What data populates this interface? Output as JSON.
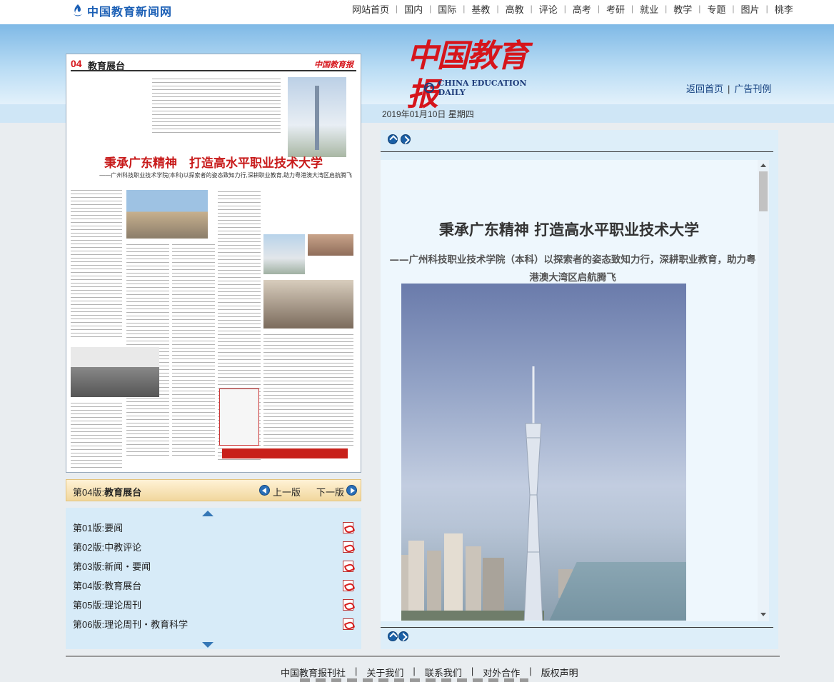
{
  "site": {
    "logo_text": "中国教育新闻网"
  },
  "topnav": [
    "网站首页",
    "国内",
    "国际",
    "基教",
    "高教",
    "评论",
    "高考",
    "考研",
    "就业",
    "教学",
    "专题",
    "图片",
    "桃李"
  ],
  "masthead": {
    "title": "中国教育报",
    "subtitle": "CHINA EDUCATION DAILY"
  },
  "header_links": {
    "home": "返回首页",
    "ads": "广告刊例"
  },
  "date": "2019年01月10日  星期四",
  "page_preview": {
    "page_num": "04",
    "section": "教育展台",
    "paper_logo": "中国教育报",
    "headline": "秉承广东精神　打造高水平职业技术大学",
    "deck": "——广州科技职业技术学院(本科)以探索者的姿态致知力行,深耕职业教育,助力粤港澳大湾区启航腾飞"
  },
  "page_nav": {
    "current_prefix": "第04版:",
    "current_name": "教育展台",
    "prev": "上一版",
    "next": "下一版"
  },
  "page_list": [
    {
      "num": "第01版:",
      "name": "要闻"
    },
    {
      "num": "第02版:",
      "name": "中教评论"
    },
    {
      "num": "第03版:",
      "name": "新闻・要闻"
    },
    {
      "num": "第04版:",
      "name": "教育展台"
    },
    {
      "num": "第05版:",
      "name": "理论周刊"
    },
    {
      "num": "第06版:",
      "name": "理论周刊・教育科学"
    }
  ],
  "article": {
    "title": "秉承广东精神 打造高水平职业技术大学",
    "subtitle": "——广州科技职业技术学院（本科）以探索者的姿态致知力行，深耕职业教育，助力粤港澳大湾区启航腾飞"
  },
  "footer": [
    "中国教育报刊社",
    "关于我们",
    "联系我们",
    "对外合作",
    "版权声明"
  ],
  "colors": {
    "brand_red": "#d6151b",
    "link_blue": "#14407f",
    "panel_blue": "#ddeef9"
  }
}
